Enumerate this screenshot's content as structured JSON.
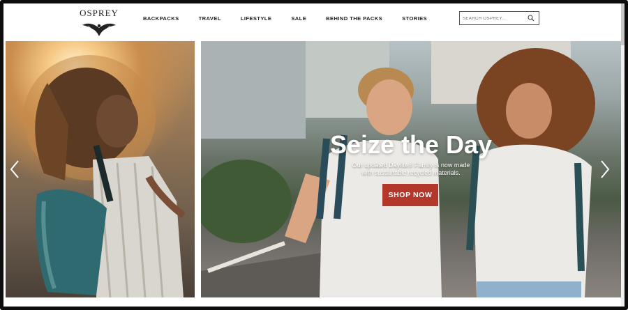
{
  "brand": {
    "name": "OSPREY"
  },
  "nav": {
    "items": [
      {
        "label": "BACKPACKS"
      },
      {
        "label": "TRAVEL"
      },
      {
        "label": "LIFESTYLE"
      },
      {
        "label": "SALE"
      },
      {
        "label": "BEHIND THE PACKS"
      },
      {
        "label": "STORIES"
      }
    ]
  },
  "search": {
    "placeholder": "SEARCH OSPREY...",
    "icon": "search-icon"
  },
  "hero": {
    "title": "Seize the Day",
    "subtitle_line1": "Our updated Daylite® Family is now made",
    "subtitle_line2": "with sustainable recycled materials.",
    "cta_label": "SHOP NOW",
    "cta_color": "#b3372a",
    "prev_icon": "chevron-left-icon",
    "next_icon": "chevron-right-icon"
  }
}
